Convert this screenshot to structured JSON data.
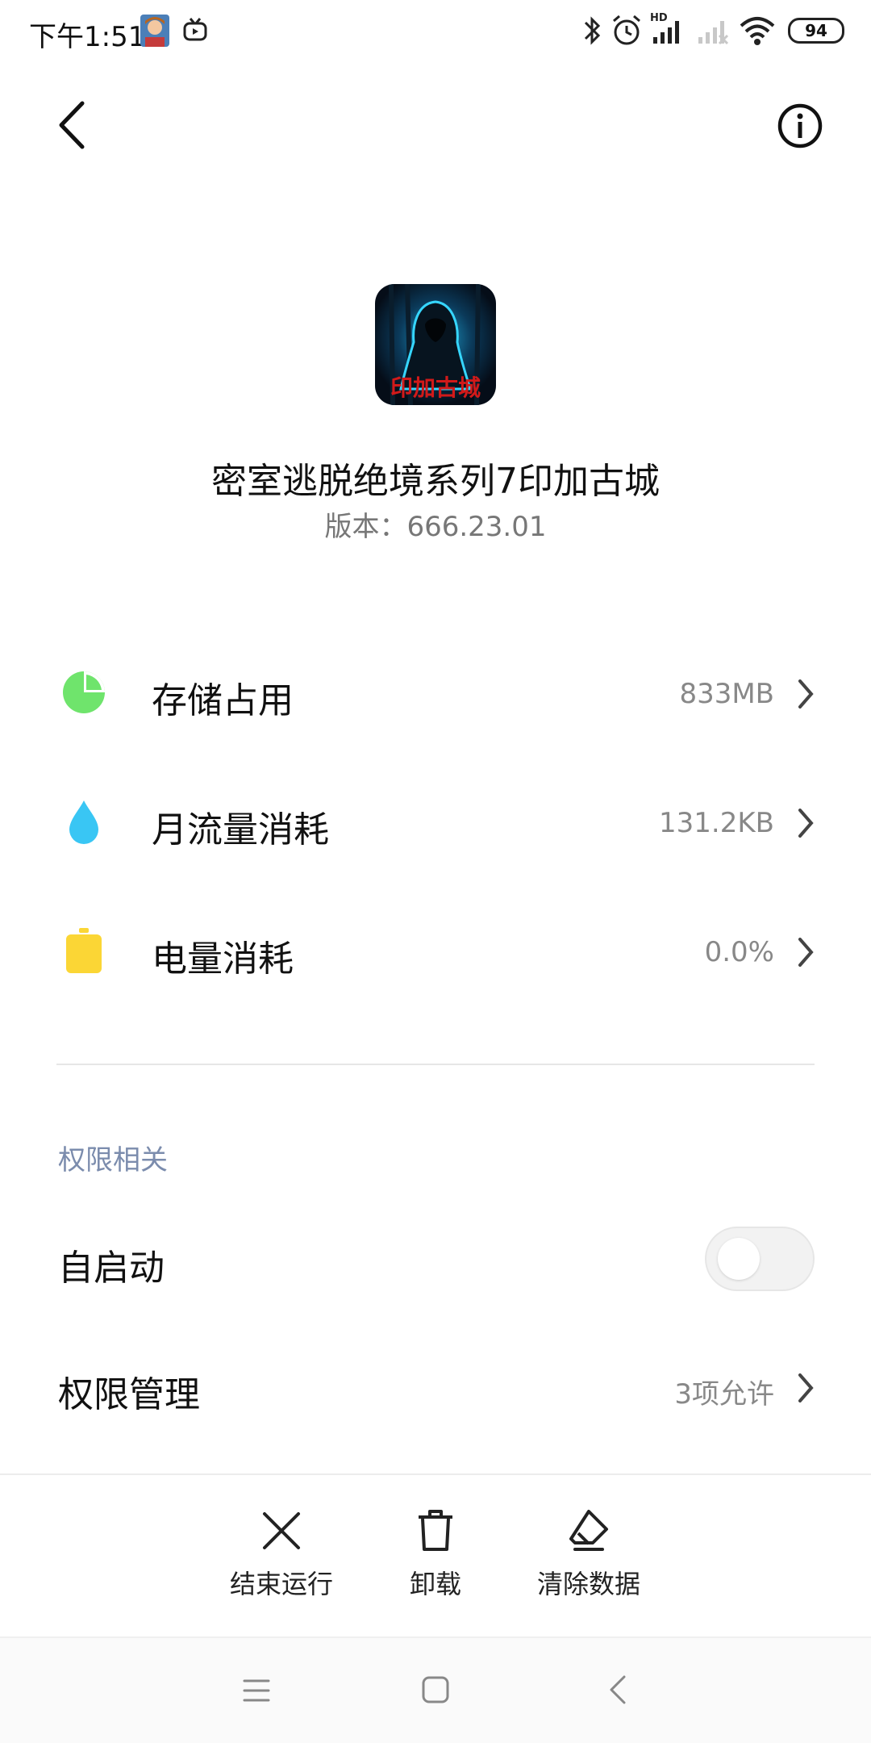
{
  "status_bar": {
    "time": "下午1:51",
    "battery": "94",
    "network_badge": "HD",
    "icons": [
      "avatar-icon",
      "tv-icon",
      "bluetooth-icon",
      "alarm-icon",
      "signal-icon",
      "signal-empty-icon",
      "wifi-icon",
      "battery-icon"
    ]
  },
  "app": {
    "name": "密室逃脱绝境系列7印加古城",
    "version_label": "版本：",
    "version": "666.23.01",
    "icon_text": "印加古城"
  },
  "usage": [
    {
      "label": "存储占用",
      "value": "833MB",
      "icon": "pie-chart-icon",
      "color": "#6fe46c"
    },
    {
      "label": "月流量消耗",
      "value": "131.2KB",
      "icon": "water-drop-icon",
      "color": "#39c6f4"
    },
    {
      "label": "电量消耗",
      "value": "0.0%",
      "icon": "battery-usage-icon",
      "color": "#fbd635"
    }
  ],
  "permissions": {
    "section_title": "权限相关",
    "autostart_label": "自启动",
    "autostart_enabled": false,
    "manage_label": "权限管理",
    "manage_value": "3项允许"
  },
  "actions": [
    {
      "label": "结束运行",
      "icon": "close-icon"
    },
    {
      "label": "卸载",
      "icon": "trash-icon"
    },
    {
      "label": "清除数据",
      "icon": "eraser-icon"
    }
  ],
  "navbar": {
    "icons": [
      "menu-icon",
      "home-icon",
      "back-nav-icon"
    ]
  }
}
